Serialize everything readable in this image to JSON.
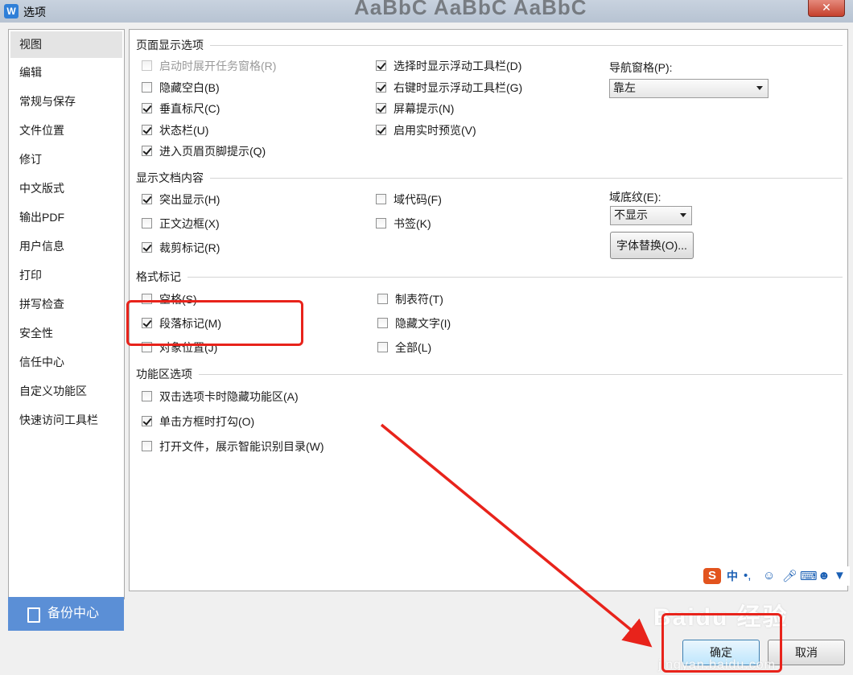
{
  "window": {
    "title": "选项",
    "app_icon_letter": "W",
    "close_glyph": "✕",
    "background_text": "AaBbC AaBbC AaBbC"
  },
  "sidebar": {
    "items": [
      {
        "label": "视图",
        "active": true
      },
      {
        "label": "编辑"
      },
      {
        "label": "常规与保存"
      },
      {
        "label": "文件位置"
      },
      {
        "label": "修订"
      },
      {
        "label": "中文版式"
      },
      {
        "label": "输出PDF"
      },
      {
        "label": "用户信息"
      },
      {
        "label": "打印"
      },
      {
        "label": "拼写检查"
      },
      {
        "label": "安全性"
      },
      {
        "label": "信任中心"
      },
      {
        "label": "自定义功能区"
      },
      {
        "label": "快速访问工具栏"
      }
    ],
    "backup_label": "备份中心"
  },
  "page_display": {
    "heading": "页面显示选项",
    "col1": [
      {
        "label": "启动时展开任务窗格(R)",
        "checked": false,
        "disabled": true
      },
      {
        "label": "隐藏空白(B)",
        "checked": false
      },
      {
        "label": "垂直标尺(C)",
        "checked": true
      },
      {
        "label": "状态栏(U)",
        "checked": true
      },
      {
        "label": "进入页眉页脚提示(Q)",
        "checked": true
      }
    ],
    "col2": [
      {
        "label": "选择时显示浮动工具栏(D)",
        "checked": true
      },
      {
        "label": "右键时显示浮动工具栏(G)",
        "checked": true
      },
      {
        "label": "屏幕提示(N)",
        "checked": true
      },
      {
        "label": "启用实时预览(V)",
        "checked": true
      }
    ],
    "nav_pane_label": "导航窗格(P):",
    "nav_pane_value": "靠左"
  },
  "doc_content": {
    "heading": "显示文档内容",
    "col1": [
      {
        "label": "突出显示(H)",
        "checked": true
      },
      {
        "label": "正文边框(X)",
        "checked": false
      },
      {
        "label": "裁剪标记(R)",
        "checked": true
      }
    ],
    "col2": [
      {
        "label": "域代码(F)",
        "checked": false
      },
      {
        "label": "书签(K)",
        "checked": false
      }
    ],
    "field_shading_label": "域底纹(E):",
    "field_shading_value": "不显示",
    "font_sub_button": "字体替换(O)..."
  },
  "format_marks": {
    "heading": "格式标记",
    "col1": [
      {
        "label": "空格(S)",
        "checked": false
      },
      {
        "label": "段落标记(M)",
        "checked": true
      },
      {
        "label": "对象位置(J)",
        "checked": false
      }
    ],
    "col2": [
      {
        "label": "制表符(T)",
        "checked": false
      },
      {
        "label": "隐藏文字(I)",
        "checked": false
      },
      {
        "label": "全部(L)",
        "checked": false
      }
    ]
  },
  "ribbon_options": {
    "heading": "功能区选项",
    "items": [
      {
        "label": "双击选项卡时隐藏功能区(A)",
        "checked": false
      },
      {
        "label": "单击方框时打勾(O)",
        "checked": true
      },
      {
        "label": "打开文件，展示智能识别目录(W)",
        "checked": false
      }
    ]
  },
  "buttons": {
    "ok": "确定",
    "cancel": "取消"
  },
  "ime_bar": {
    "logo": "S",
    "mode": "中"
  },
  "watermark": {
    "brand": "Baidu 经验",
    "url": "jingyan.baidu.com"
  },
  "colors": {
    "annotation_red": "#e8231b",
    "backup_blue": "#5b8fd6"
  }
}
